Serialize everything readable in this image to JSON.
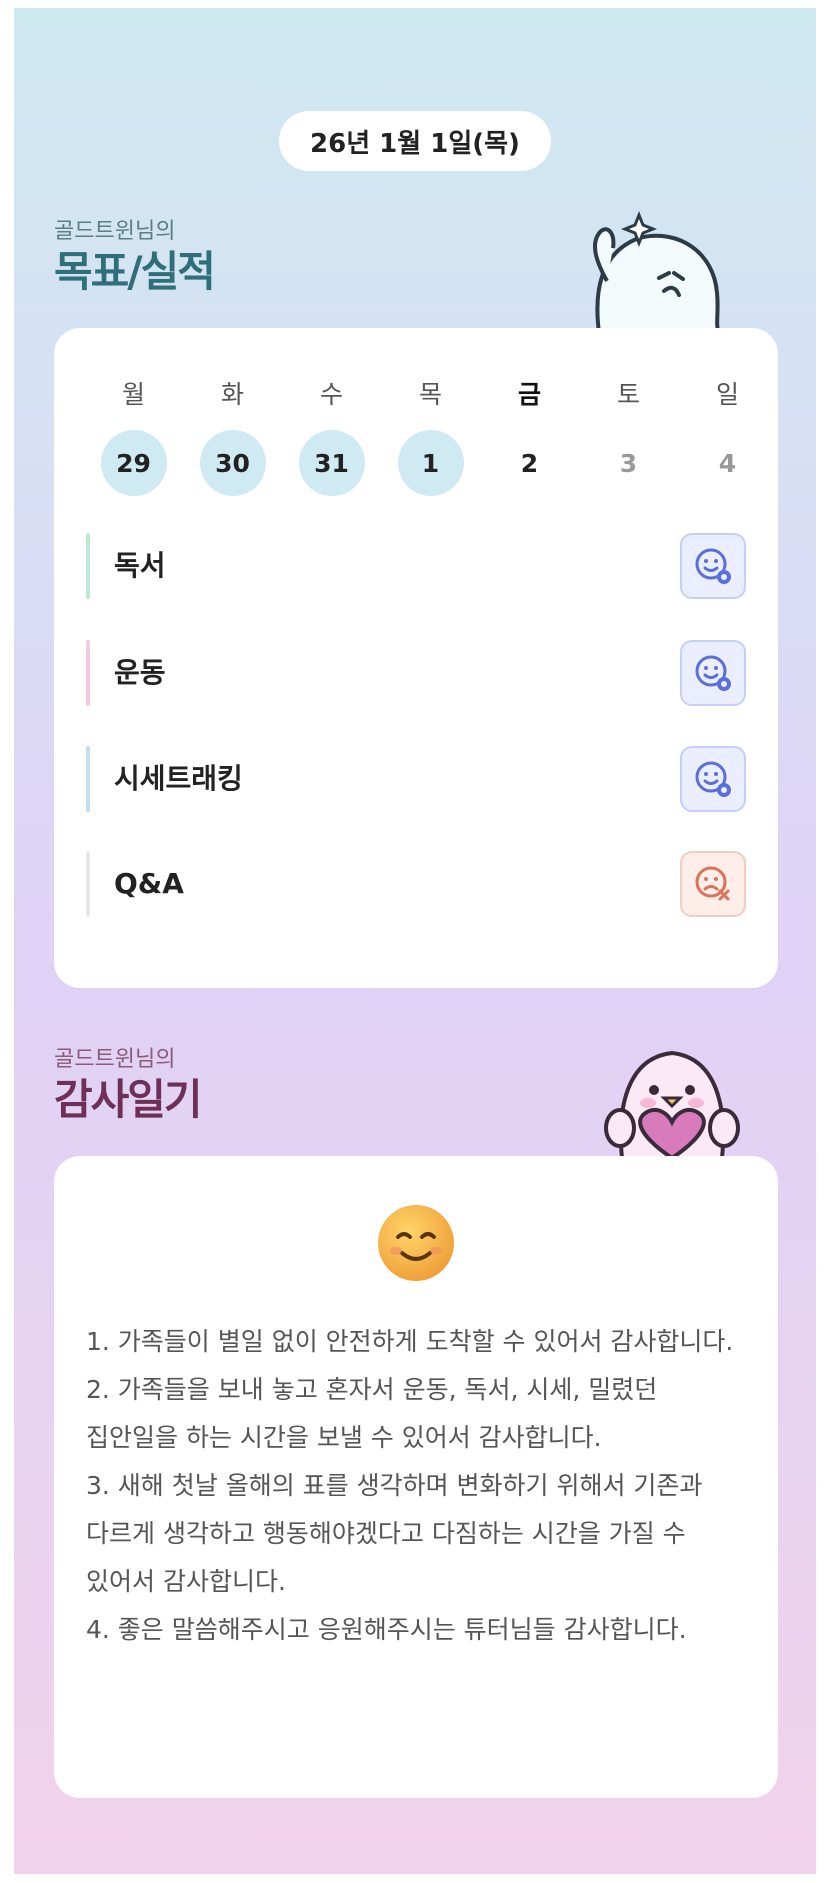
{
  "date_label": "26년 1월 1일(목)",
  "goals_section": {
    "subtitle": "골드트윈님의",
    "title": "목표/실적",
    "weekdays": [
      "월",
      "화",
      "수",
      "목",
      "금",
      "토",
      "일"
    ],
    "days": [
      "29",
      "30",
      "31",
      "1",
      "2",
      "3",
      "4"
    ],
    "goals": [
      {
        "label": "독서",
        "status": "success",
        "bar_color": "#bfe8d2"
      },
      {
        "label": "운동",
        "status": "success",
        "bar_color": "#f5c8e3"
      },
      {
        "label": "시세트래킹",
        "status": "success",
        "bar_color": "#bfe0ec"
      },
      {
        "label": "Q&A",
        "status": "fail",
        "bar_color": "#e6e6e6"
      }
    ]
  },
  "gratitude_section": {
    "subtitle": "골드트윈님의",
    "title": "감사일기",
    "text": "1. 가족들이 별일 없이 안전하게 도착할 수 있어서 감사합니다.\n2. 가족들을 보내 놓고 혼자서 운동, 독서, 시세, 밀렸던 집안일을 하는 시간을 보낼 수 있어서 감사합니다.\n3. 새해 첫날 올해의 표를 생각하며 변화하기 위해서 기존과 다르게 생각하고 행동해야겠다고 다짐하는 시간을 가질 수 있어서 감사합니다.\n4. 좋은 말씀해주시고 응원해주시는 튜터님들 감사합니다."
  },
  "colors": {
    "success_icon": "#5b6fd8",
    "fail_icon": "#d9735a",
    "done_day_bg": "#cfeaf2"
  }
}
